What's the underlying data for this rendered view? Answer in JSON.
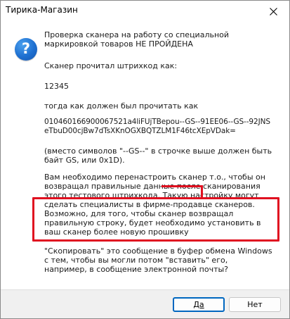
{
  "window": {
    "title": "Тирика-Магазин"
  },
  "icons": {
    "dialog_icon": "question-icon",
    "close": "close-icon"
  },
  "message": {
    "heading": "Проверка сканера на работу со специальной маркировкой товаров НЕ ПРОЙДЕНА",
    "scanned_label": "Сканер прочитал штрихкод как:",
    "scanned_value": "12345",
    "expected_label": "тогда как должен был прочитать как",
    "expected_value": "010460166900067521a4liFUjTBepou--GS--91EE06--GS--92JNSeTbuD00cjBw7dTsXKnOGXBQTZLM1F46tcXEpVDak=",
    "gs_note": "(вместо символов \"--GS--\" в строчке выше должен быть байт GS, или 0x1D).",
    "reconfigure_text": "Вам необходимо перенастроить сканер т.о., чтобы он возвращал правильные данные после сканирования этого тестового штрихкода. Такую настройку могут сделать специалисты в фирме-продавце сканеров. Возможно, для того, чтобы сканер возвращал правильную строку, будет необходимо установить в ваш сканер более новую прошивку",
    "copy_prompt": "\"Скопировать\" это сообщение в буфер обмена Windows с тем, чтобы вы могли потом \"вставить\" его, например, в сообщение электронной почты?"
  },
  "buttons": {
    "yes_label": "Да",
    "no_label": "Нет"
  },
  "colors": {
    "accent": "#0067c0",
    "highlight": "#e01020",
    "icon_blue": "#1e6fd0"
  }
}
